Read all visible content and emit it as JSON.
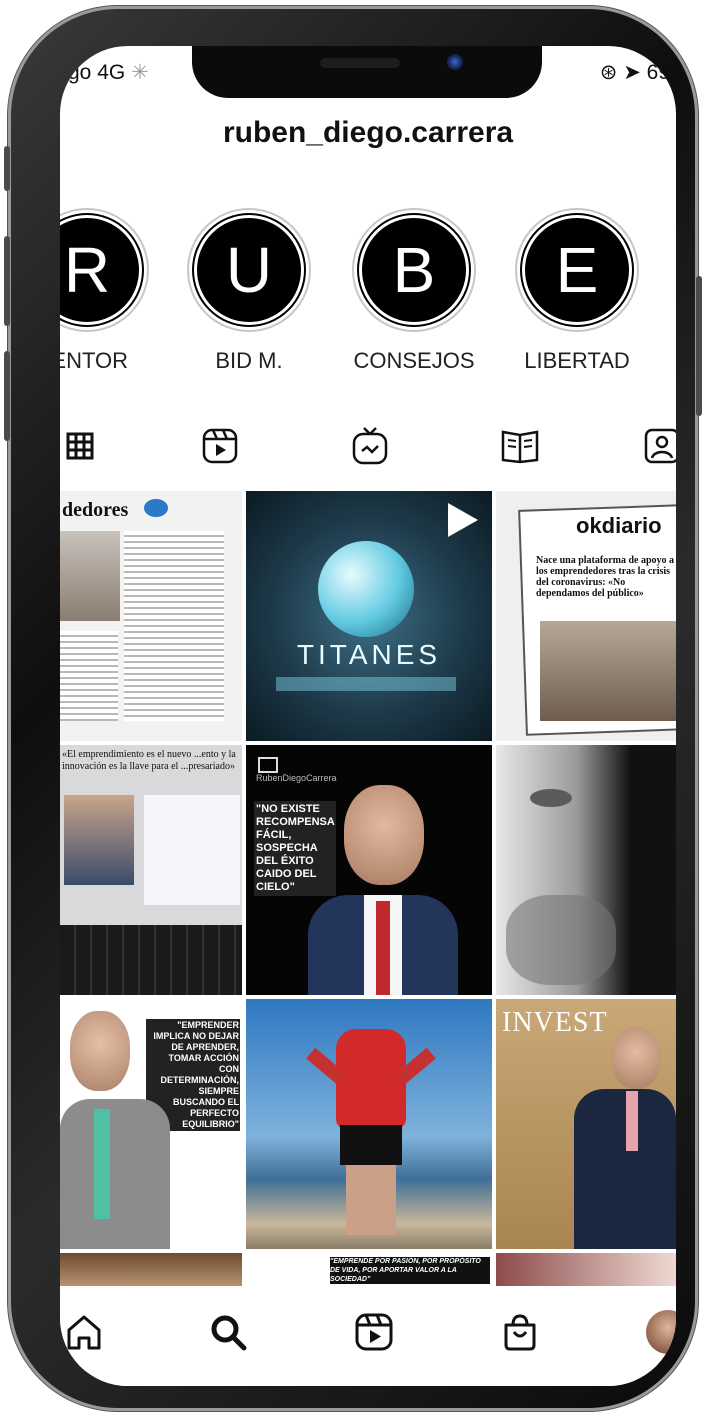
{
  "status_bar": {
    "left": "go  4G",
    "right": "69"
  },
  "profile": {
    "username": "ruben_diego.carrera"
  },
  "highlights": [
    {
      "letter": "R",
      "label": "ENTOR"
    },
    {
      "letter": "U",
      "label": "BID M."
    },
    {
      "letter": "B",
      "label": "CONSEJOS"
    },
    {
      "letter": "E",
      "label": "LIBERTAD"
    }
  ],
  "tabs": [
    "grid",
    "reels",
    "igtv",
    "guides",
    "tagged"
  ],
  "posts": {
    "p1_heading": "dedores",
    "p2_title": "TITANES",
    "p3_brand": "okdiario",
    "p3_headline": "Nace una plataforma de apoyo a los emprendedores tras la crisis del coronavirus: «No dependamos del público»",
    "p4_headline": "«El emprendimiento es el nuevo ...ento y la innovación es la llave para el ...presariado»",
    "p5_brand": "RubenDiegoCarrera",
    "p5_quote": "\"NO EXISTE RECOMPENSA FÁCIL, SOSPECHA DEL ÉXITO CAIDO DEL CIELO\"",
    "p7_quote": "\"EMPRENDER IMPLICA NO DEJAR DE APRENDER, TOMAR ACCIÓN CON DETERMINACIÓN, SIEMPRE BUSCANDO EL PERFECTO EQUILIBRIO\"",
    "p9_heading": "INVEST",
    "p11_quote": "\"EMPRENDE POR PASIÓN, POR PROPÓSITO DE VIDA, POR APORTAR VALOR A LA SOCIEDAD\""
  },
  "colors": {
    "accent": "#000000",
    "background": "#ffffff"
  }
}
